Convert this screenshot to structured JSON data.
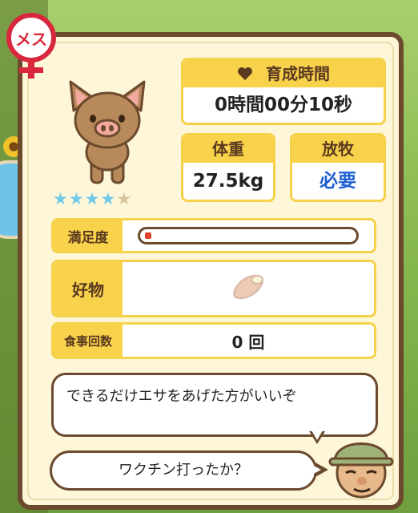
{
  "gender": {
    "label": "メス",
    "color": "#d9283d"
  },
  "pig": {
    "rating": 4,
    "max_rating": 5,
    "icon": "pig-icon"
  },
  "growth_time": {
    "label": "育成時間",
    "value": "0時間00分10秒",
    "icon": "heart-icon"
  },
  "weight": {
    "label": "体重",
    "value": "27.5kg"
  },
  "grazing": {
    "label": "放牧",
    "value": "必要",
    "value_color": "#1f5fd0"
  },
  "satisfaction": {
    "label": "満足度",
    "level": 0.03
  },
  "favorite": {
    "label": "好物",
    "item_icon": "sweet-potato-icon"
  },
  "meals": {
    "label": "食事回数",
    "value": "0 回"
  },
  "messages": [
    {
      "text": "できるだけエサをあげた方がいいぞ"
    },
    {
      "text": "ワクチン打ったか？"
    }
  ],
  "colors": {
    "panel_bg": "#fdf6d8",
    "border": "#6b4a2e",
    "accent": "#f8d24a"
  }
}
